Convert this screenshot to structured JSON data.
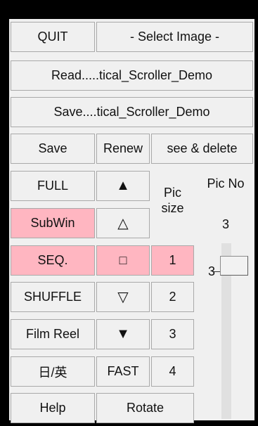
{
  "buttons": {
    "quit": "QUIT",
    "select_image": "- Select Image -",
    "read": "Read.....tical_Scroller_Demo",
    "save_path": "Save....tical_Scroller_Demo",
    "save": "Save",
    "renew": "Renew",
    "see_delete": "see & delete",
    "full": "FULL",
    "subwin": "SubWin",
    "seq": "SEQ.",
    "shuffle": "SHUFFLE",
    "film_reel": "Film Reel",
    "lang": "日/英",
    "help": "Help",
    "fast": "FAST",
    "rotate": "Rotate"
  },
  "arrows": {
    "up_filled": "▲",
    "up_outline": "△",
    "square": "□",
    "down_outline": "▽",
    "down_filled": "▼"
  },
  "pic_size": {
    "label": "Pic\nsize",
    "options": [
      "1",
      "2",
      "3",
      "4"
    ],
    "selected": "1"
  },
  "pic_no": {
    "label": "Pic No",
    "value": "3",
    "slider_value": "3"
  },
  "colors": {
    "active_pink": "#ffb6c1",
    "panel_bg": "#f0f0f0"
  }
}
